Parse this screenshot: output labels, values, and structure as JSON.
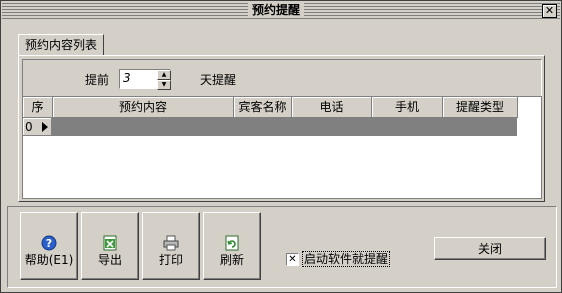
{
  "window": {
    "title": "预约提醒",
    "close_glyph": "✕"
  },
  "tabs": [
    {
      "label": "预约内容列表"
    }
  ],
  "toolbar": {
    "before_label": "提前",
    "days_value": "3",
    "days_label": "天提醒"
  },
  "grid": {
    "columns": [
      "序",
      "预约内容",
      "宾客名称",
      "电话",
      "手机",
      "提醒类型"
    ],
    "rows": [
      {
        "idx": "0"
      }
    ]
  },
  "buttons": {
    "help": "帮助(E1)",
    "export": "导出",
    "print": "打印",
    "refresh": "刷新",
    "close": "关闭"
  },
  "startup_checkbox": {
    "label": "启动软件就提醒",
    "checked": true,
    "glyph": "✕"
  },
  "colors": {
    "window_bg": "#d4d0c8",
    "row_fill": "#808080"
  }
}
